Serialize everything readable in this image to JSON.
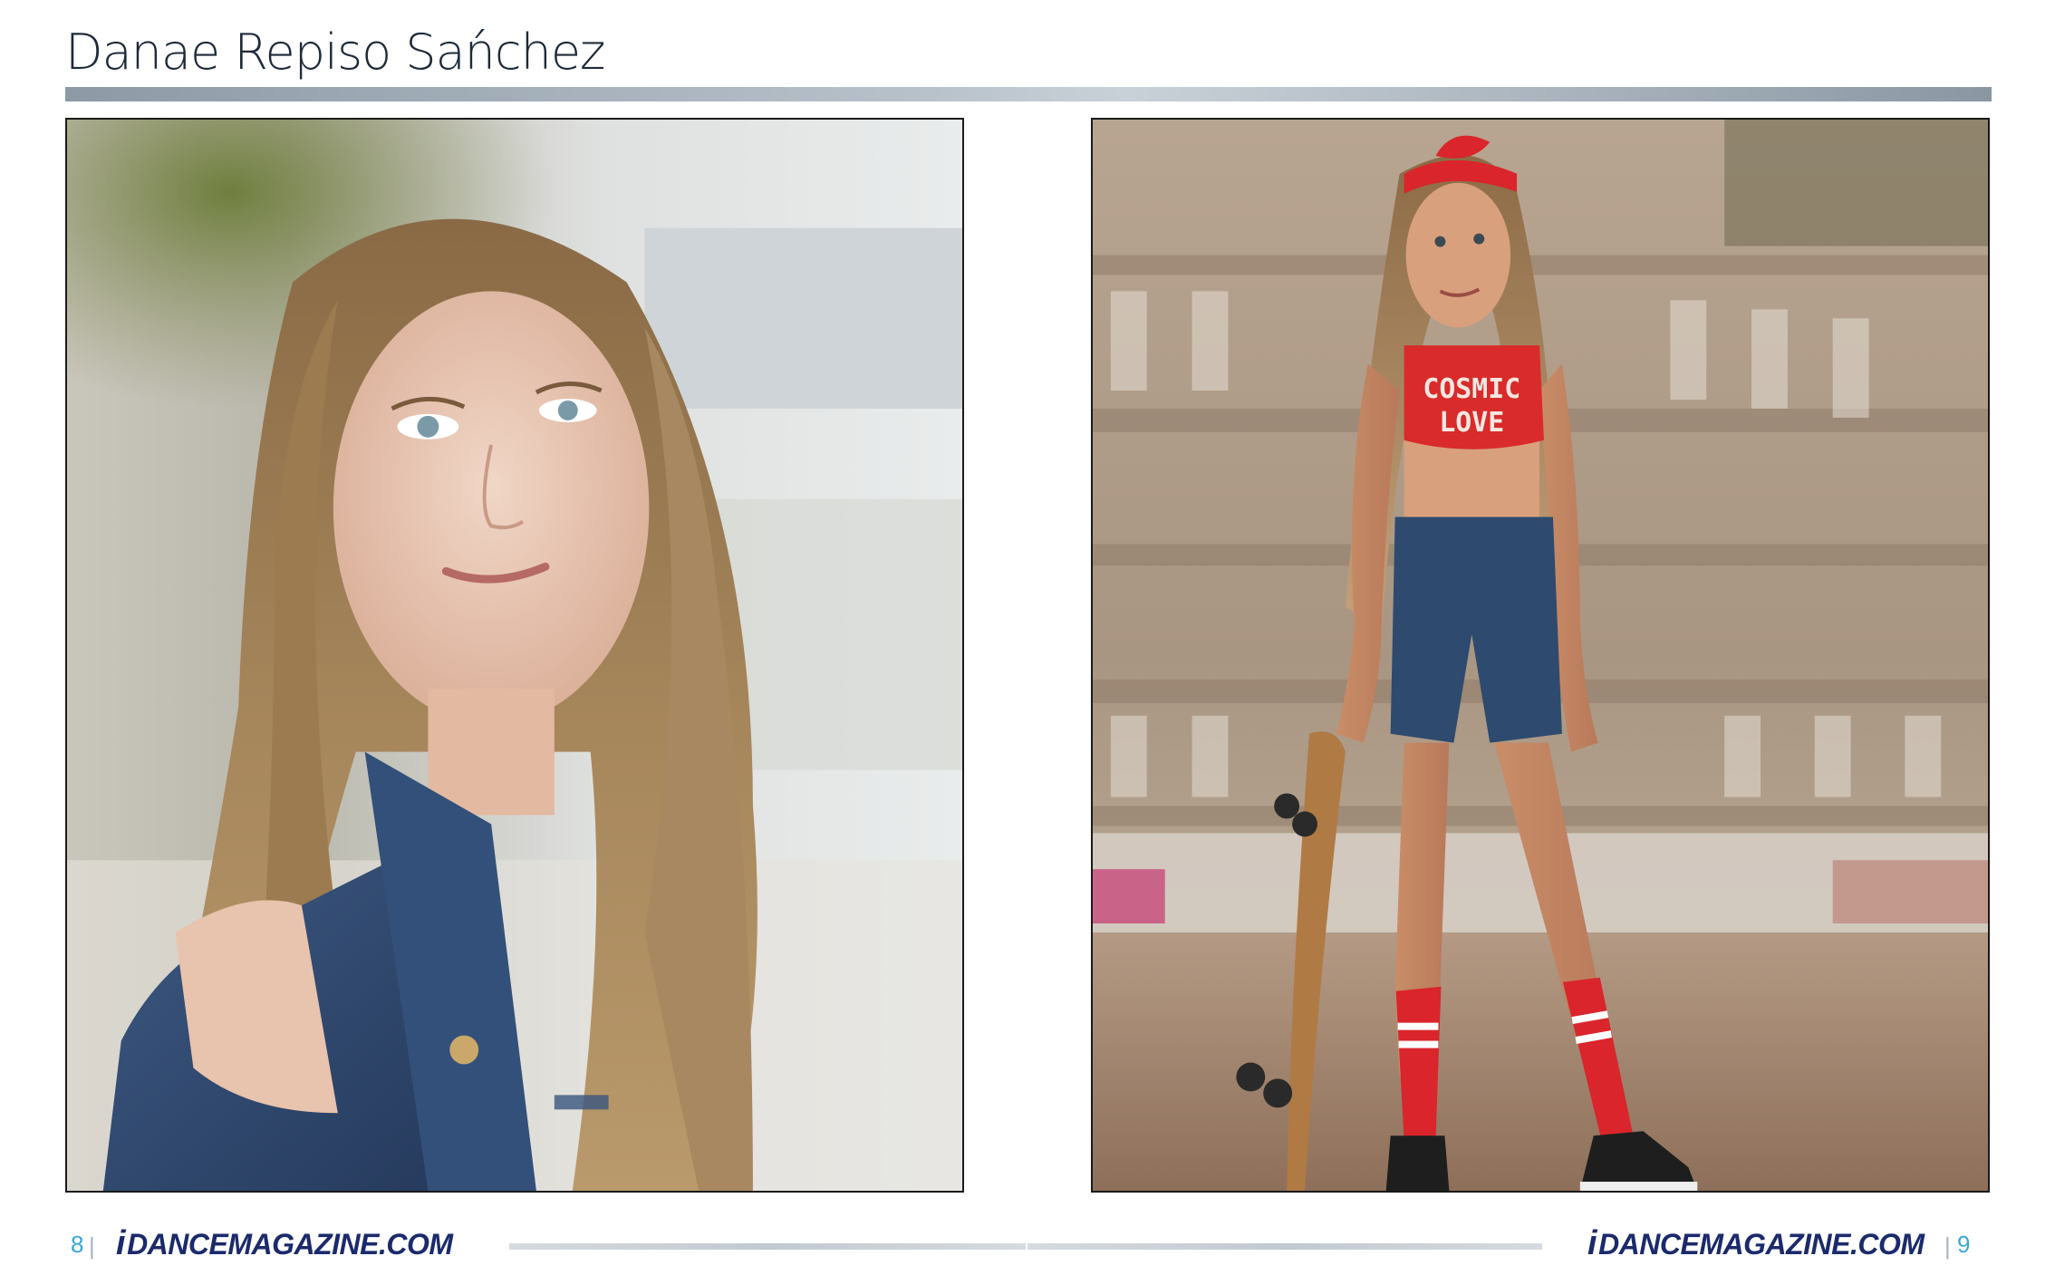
{
  "header": {
    "title": "Danae Repiso Sańchez"
  },
  "photos": {
    "left": {
      "subject": "portrait-denim-vest"
    },
    "right": {
      "subject": "skateboard-cosmic-love",
      "shirt_line1": "COSMIC",
      "shirt_line2": "LOVE"
    }
  },
  "footer": {
    "left_page": "8",
    "right_page": "9",
    "left_separator": "|",
    "right_separator": "|",
    "logo_i": "i",
    "logo_dance": "DANCE",
    "logo_magazine": "MAGAZINE",
    "logo_com": ".COM"
  },
  "colors": {
    "accent": "#3aa6d8",
    "brand": "#1b2a6b",
    "rule": "#9aa6b1"
  }
}
